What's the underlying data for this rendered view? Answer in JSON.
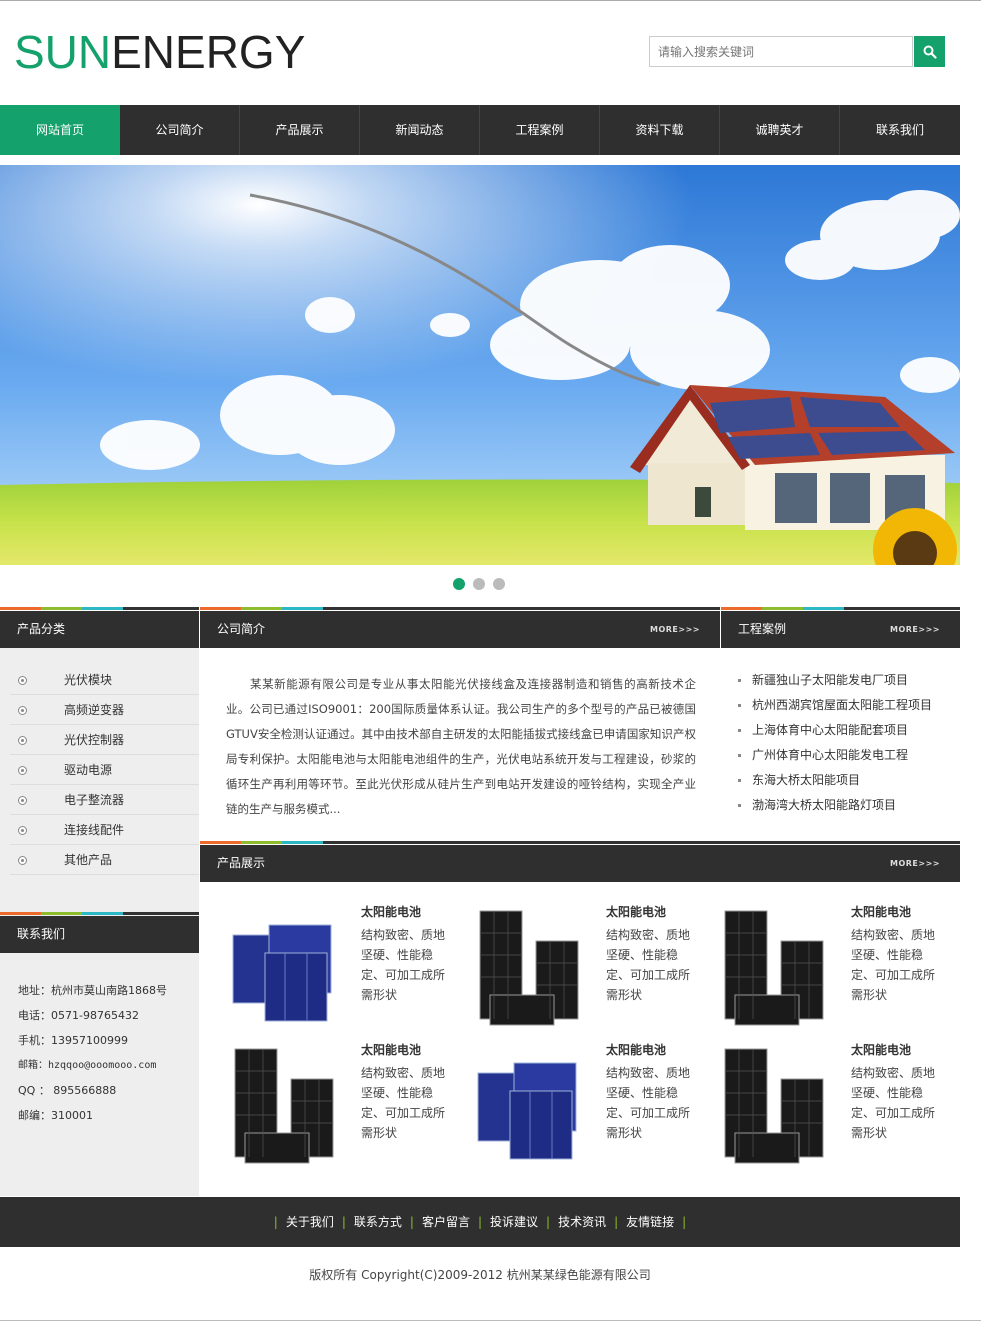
{
  "logo": {
    "part1": "SUN",
    "part2": "ENERGY"
  },
  "search": {
    "placeholder": "请输入搜索关键词"
  },
  "nav": [
    "网站首页",
    "公司简介",
    "产品展示",
    "新闻动态",
    "工程案例",
    "资料下载",
    "诚聘英才",
    "联系我们"
  ],
  "banner": {
    "slides": 3,
    "active_slide": 1
  },
  "sections": {
    "categories_title": "产品分类",
    "about_title": "公司简介",
    "cases_title": "工程案例",
    "products_title": "产品展示",
    "contact_title": "联系我们",
    "more_label": "MORE>>>"
  },
  "categories": [
    "光伏模块",
    "高频逆变器",
    "光伏控制器",
    "驱动电源",
    "电子整流器",
    "连接线配件",
    "其他产品"
  ],
  "about_text": "某某新能源有限公司是专业从事太阳能光伏接线盒及连接器制造和销售的高新技术企业。公司已通过ISO9001：200国际质量体系认证。我公司生产的多个型号的产品已被德国GTUV安全检测认证通过。其中由技术部自主研发的太阳能插拔式接线盒已申请国家知识产权局专利保护。太阳能电池与太阳能电池组件的生产，光伏电站系统开发与工程建设，砂浆的循环生产再利用等环节。至此光伏形成从硅片生产到电站开发建设的哑铃结构，实现全产业链的生产与服务模式...",
  "cases": [
    "新疆独山子太阳能发电厂项目",
    "杭州西湖宾馆屋面太阳能工程项目",
    "上海体育中心太阳能配套项目",
    "广州体育中心太阳能发电工程",
    "东海大桥太阳能项目",
    "渤海湾大桥太阳能路灯项目"
  ],
  "contact": {
    "address": "地址：杭州市莫山南路1868号",
    "phone": "电话：0571-98765432",
    "mobile": "手机：13957100999",
    "email": "邮箱：hzqqoo@ooomooo.com",
    "qq": "QQ ： 895566888",
    "zip": "邮编：310001"
  },
  "products": [
    {
      "title": "太阳能电池",
      "desc": "结构致密、质地坚硬、性能稳定、可加工成所需形状",
      "image": "blue-cells"
    },
    {
      "title": "太阳能电池",
      "desc": "结构致密、质地坚硬、性能稳定、可加工成所需形状",
      "image": "black-panels"
    },
    {
      "title": "太阳能电池",
      "desc": "结构致密、质地坚硬、性能稳定、可加工成所需形状",
      "image": "black-panels"
    },
    {
      "title": "太阳能电池",
      "desc": "结构致密、质地坚硬、性能稳定、可加工成所需形状",
      "image": "black-panels"
    },
    {
      "title": "太阳能电池",
      "desc": "结构致密、质地坚硬、性能稳定、可加工成所需形状",
      "image": "blue-cells"
    },
    {
      "title": "太阳能电池",
      "desc": "结构致密、质地坚硬、性能稳定、可加工成所需形状",
      "image": "black-panels"
    }
  ],
  "footer_links": [
    "关于我们",
    "联系方式",
    "客户留言",
    "投诉建议",
    "技术资讯",
    "友情链接"
  ],
  "copyright": "版权所有  Copyright(C)2009-2012 杭州某某绿色能源有限公司",
  "colors": {
    "accent": "#14a16b",
    "dark": "#2f2f2f",
    "stripe_orange": "#ec6b2c",
    "stripe_green": "#8dbd2c",
    "stripe_cyan": "#2bb7c4"
  }
}
